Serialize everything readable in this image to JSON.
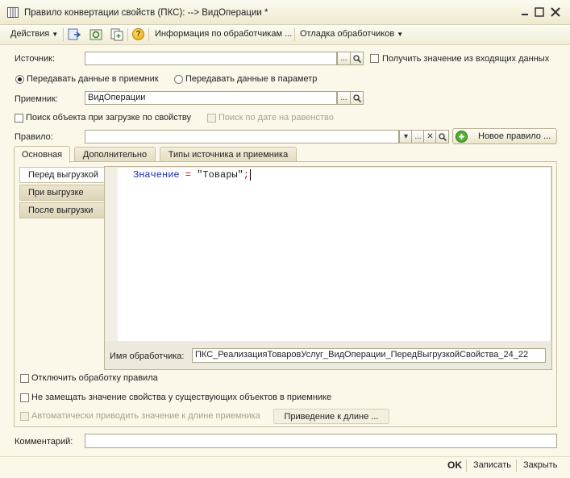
{
  "window": {
    "title": "Правило конвертации свойств (ПКС): --> ВидОперации *",
    "minimize": "_",
    "maximize": "☐",
    "close": "✕"
  },
  "toolbar": {
    "actions_label": "Действия",
    "handlers_info_label": "Информация по обработчикам ...",
    "debug_label": "Отладка обработчиков",
    "help_label": "?"
  },
  "form": {
    "source_label": "Источник:",
    "source_value": "",
    "get_from_input_label": "Получить значение из входящих данных",
    "radio_receiver_label": "Передавать данные в приемник",
    "radio_param_label": "Передавать данные в параметр",
    "receiver_label": "Приемник:",
    "receiver_value": "ВидОперации",
    "search_by_property_label": "Поиск объекта при загрузке по свойству",
    "search_by_date_label": "Поиск по дате на равенство",
    "rule_label": "Правило:",
    "rule_value": "",
    "new_rule_label": "Новое правило ...",
    "ellipsis": "...",
    "clear": "✕",
    "dropdown": "▾"
  },
  "tabs": [
    {
      "label": "Основная"
    },
    {
      "label": "Дополнительно"
    },
    {
      "label": "Типы источника и приемника"
    }
  ],
  "event_tabs": [
    {
      "label": "Перед выгрузкой"
    },
    {
      "label": "При выгрузке"
    },
    {
      "label": "После выгрузки"
    }
  ],
  "editor": {
    "code_var": "Значение",
    "code_op": " = ",
    "code_str": "\"Товары\"",
    "code_end": ";",
    "handler_label": "Имя обработчика:",
    "handler_value": "ПКС_РеализацияТоваровУслуг_ВидОперации_ПередВыгрузкойСвойства_24_22"
  },
  "options": {
    "disable_rule_label": "Отключить обработку правила",
    "no_replace_label": "Не замещать значение свойства у существующих объектов в приемнике",
    "auto_length_label": "Автоматически приводить значение к длине приемника",
    "to_length_button": "Приведение к длине ..."
  },
  "comment": {
    "label": "Комментарий:",
    "value": ""
  },
  "footer": {
    "ok": "OK",
    "save": "Записать",
    "close": "Закрыть"
  },
  "colors": {
    "window_bg": "#fbf8ea",
    "code_keyword": "#1a2fb0",
    "code_string": "#222222",
    "new_rule_icon": "#4caf2f"
  }
}
